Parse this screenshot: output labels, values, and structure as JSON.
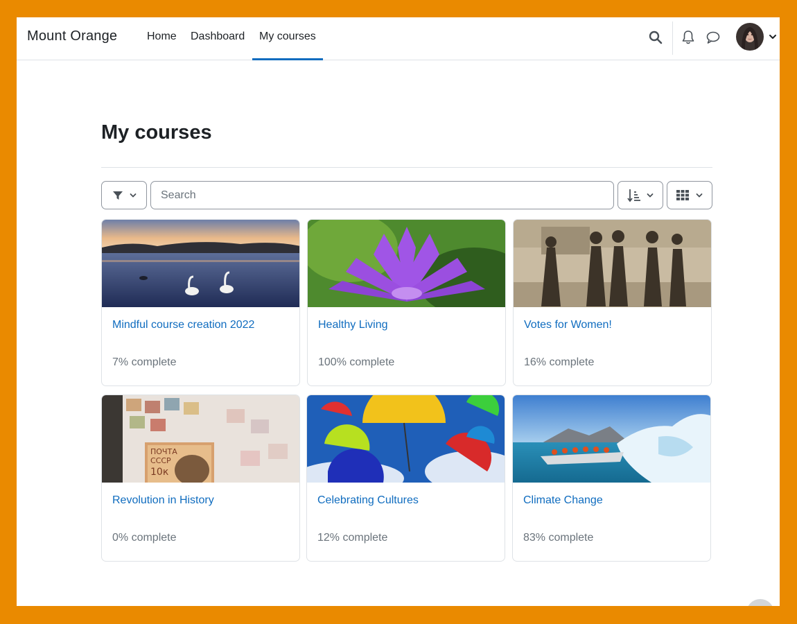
{
  "site": {
    "brand": "Mount Orange"
  },
  "nav": {
    "items": [
      {
        "label": "Home"
      },
      {
        "label": "Dashboard"
      },
      {
        "label": "My courses",
        "active": true
      }
    ]
  },
  "header_icons": [
    "search-icon",
    "bell-icon",
    "message-icon",
    "avatar",
    "chevron-down-icon"
  ],
  "page": {
    "title": "My courses"
  },
  "toolbar": {
    "filter_icon": "filter-icon",
    "search_placeholder": "Search",
    "search_value": "",
    "sort_icon": "sort-icon",
    "view_icon": "grid-icon"
  },
  "courses": [
    {
      "title": "Mindful course creation 2022",
      "progress": "7% complete",
      "image": "swans-on-lake"
    },
    {
      "title": "Healthy Living",
      "progress": "100% complete",
      "image": "purple-water-lily"
    },
    {
      "title": "Votes for Women!",
      "progress": "16% complete",
      "image": "suffragettes-sepia-photo"
    },
    {
      "title": "Revolution in History",
      "progress": "0% complete",
      "image": "postage-stamps"
    },
    {
      "title": "Celebrating Cultures",
      "progress": "12% complete",
      "image": "colorful-umbrellas"
    },
    {
      "title": "Climate Change",
      "progress": "83% complete",
      "image": "boat-near-iceberg"
    }
  ],
  "colors": {
    "frame": "#ea8a00",
    "link": "#0f6cbf",
    "active_tab": "#0f6cbf",
    "muted": "#6a737b"
  }
}
